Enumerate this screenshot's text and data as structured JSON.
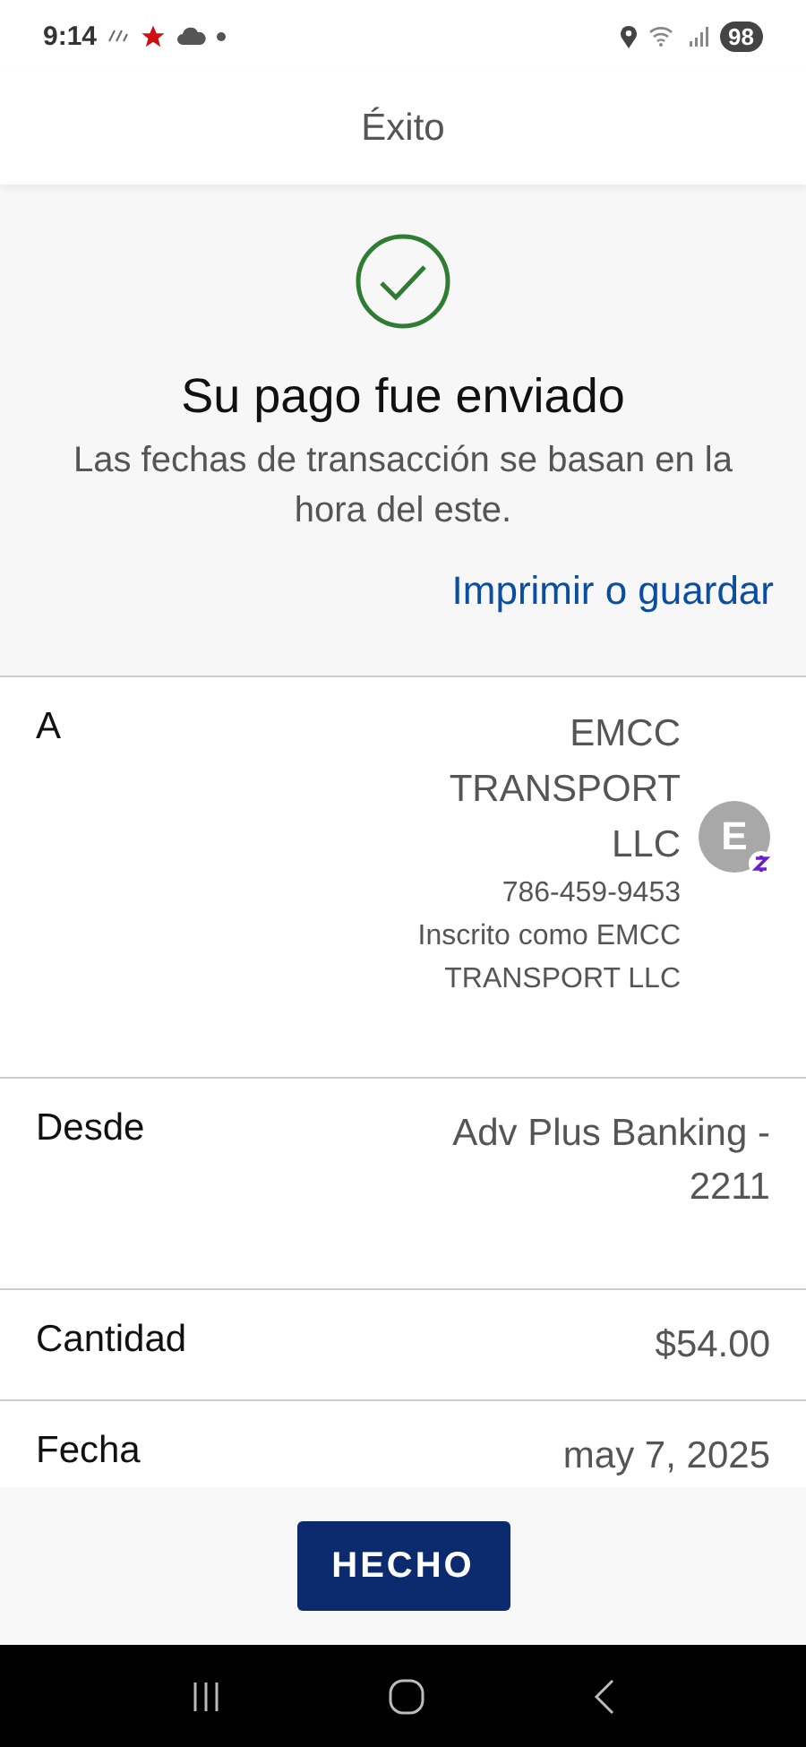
{
  "status_bar": {
    "time": "9:14",
    "battery": "98"
  },
  "header": {
    "title": "Éxito"
  },
  "confirmation": {
    "title": "Su pago fue enviado",
    "message": "Las fechas de transacción se basan en la hora del este.",
    "link": "Imprimir o guardar"
  },
  "details": [
    {
      "kind": "recipient",
      "label": "A",
      "name": "EMCC TRANSPORT LLC",
      "phone": "786-459-9453",
      "enrolled": "Inscrito como EMCC TRANSPORT LLC",
      "avatar": "E"
    },
    {
      "kind": "plain",
      "label": "Desde",
      "value": "Adv Plus Banking - 2211"
    },
    {
      "kind": "plain",
      "label": "Cantidad",
      "value": "$54.00"
    },
    {
      "kind": "plain",
      "label": "Fecha",
      "value": "may 7, 2025"
    }
  ],
  "footer": {
    "button": "HECHO"
  }
}
